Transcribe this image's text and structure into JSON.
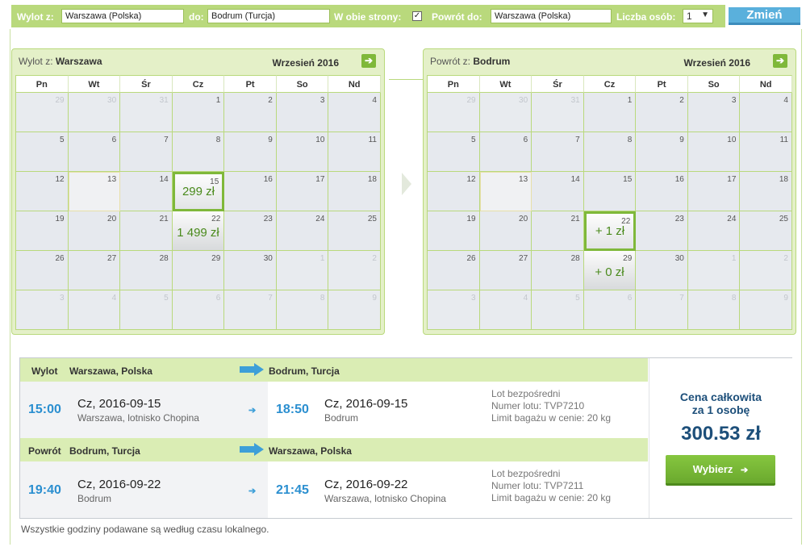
{
  "search": {
    "from_label": "Wylot z:",
    "from_value": "Warszawa (Polska)",
    "to_label": "do:",
    "to_value": "Bodrum (Turcja)",
    "roundtrip_label": "W obie strony:",
    "roundtrip_checked": "✓",
    "return_label": "Powrót do:",
    "return_value": "Warszawa (Polska)",
    "persons_label": "Liczba osób:",
    "persons_value": "1",
    "persons_arrow": "▼",
    "submit_label": "Zmień"
  },
  "weekdays": [
    "Pn",
    "Wt",
    "Śr",
    "Cz",
    "Pt",
    "So",
    "Nd"
  ],
  "outbound_calendar": {
    "title_prefix": "Wylot z:",
    "title_city": "Warszawa",
    "month": "Wrzesień 2016",
    "next_icon": "➔",
    "days": [
      {
        "d": "29",
        "o": true
      },
      {
        "d": "30",
        "o": true
      },
      {
        "d": "31",
        "o": true
      },
      {
        "d": "1"
      },
      {
        "d": "2"
      },
      {
        "d": "3"
      },
      {
        "d": "4"
      },
      {
        "d": "5"
      },
      {
        "d": "6"
      },
      {
        "d": "7"
      },
      {
        "d": "8"
      },
      {
        "d": "9"
      },
      {
        "d": "10"
      },
      {
        "d": "11"
      },
      {
        "d": "12"
      },
      {
        "d": "13",
        "today": true
      },
      {
        "d": "14"
      },
      {
        "d": "15",
        "price": "299 zł",
        "selected": true
      },
      {
        "d": "16"
      },
      {
        "d": "17"
      },
      {
        "d": "18"
      },
      {
        "d": "19"
      },
      {
        "d": "20"
      },
      {
        "d": "21"
      },
      {
        "d": "22",
        "price": "1 499 zł"
      },
      {
        "d": "23"
      },
      {
        "d": "24"
      },
      {
        "d": "25"
      },
      {
        "d": "26"
      },
      {
        "d": "27"
      },
      {
        "d": "28"
      },
      {
        "d": "29"
      },
      {
        "d": "30"
      },
      {
        "d": "1",
        "o": true
      },
      {
        "d": "2",
        "o": true
      },
      {
        "d": "3",
        "o": true
      },
      {
        "d": "4",
        "o": true
      },
      {
        "d": "5",
        "o": true
      },
      {
        "d": "6",
        "o": true
      },
      {
        "d": "7",
        "o": true
      },
      {
        "d": "8",
        "o": true
      },
      {
        "d": "9",
        "o": true
      }
    ]
  },
  "return_calendar": {
    "title_prefix": "Powrót z:",
    "title_city": "Bodrum",
    "month": "Wrzesień 2016",
    "next_icon": "➔",
    "days": [
      {
        "d": "29",
        "o": true
      },
      {
        "d": "30",
        "o": true
      },
      {
        "d": "31",
        "o": true
      },
      {
        "d": "1"
      },
      {
        "d": "2"
      },
      {
        "d": "3"
      },
      {
        "d": "4"
      },
      {
        "d": "5"
      },
      {
        "d": "6"
      },
      {
        "d": "7"
      },
      {
        "d": "8"
      },
      {
        "d": "9"
      },
      {
        "d": "10"
      },
      {
        "d": "11"
      },
      {
        "d": "12"
      },
      {
        "d": "13",
        "today": true
      },
      {
        "d": "14"
      },
      {
        "d": "15"
      },
      {
        "d": "16"
      },
      {
        "d": "17"
      },
      {
        "d": "18"
      },
      {
        "d": "19"
      },
      {
        "d": "20"
      },
      {
        "d": "21"
      },
      {
        "d": "22",
        "price": "+ 1 zł",
        "selected": true
      },
      {
        "d": "23"
      },
      {
        "d": "24"
      },
      {
        "d": "25"
      },
      {
        "d": "26"
      },
      {
        "d": "27"
      },
      {
        "d": "28"
      },
      {
        "d": "29",
        "price": "+ 0 zł"
      },
      {
        "d": "30"
      },
      {
        "d": "1",
        "o": true
      },
      {
        "d": "2",
        "o": true
      },
      {
        "d": "3",
        "o": true
      },
      {
        "d": "4",
        "o": true
      },
      {
        "d": "5",
        "o": true
      },
      {
        "d": "6",
        "o": true
      },
      {
        "d": "7",
        "o": true
      },
      {
        "d": "8",
        "o": true
      },
      {
        "d": "9",
        "o": true
      }
    ]
  },
  "summary": {
    "outbound": {
      "label": "Wylot",
      "from": "Warszawa, Polska",
      "to": "Bodrum, Turcja",
      "dep_time": "15:00",
      "dep_date": "Cz, 2016-09-15",
      "dep_place": "Warszawa, lotnisko Chopina",
      "arr_time": "18:50",
      "arr_date": "Cz, 2016-09-15",
      "arr_place": "Bodrum",
      "info_direct": "Lot bezpośredni",
      "info_flight": "Numer lotu: TVP7210",
      "info_baggage": "Limit bagażu w cenie: 20 kg"
    },
    "return": {
      "label": "Powrót",
      "from": "Bodrum, Turcja",
      "to": "Warszawa, Polska",
      "dep_time": "19:40",
      "dep_date": "Cz, 2016-09-22",
      "dep_place": "Bodrum",
      "arr_time": "21:45",
      "arr_date": "Cz, 2016-09-22",
      "arr_place": "Warszawa, lotnisko Chopina",
      "info_direct": "Lot bezpośredni",
      "info_flight": "Numer lotu: TVP7211",
      "info_baggage": "Limit bagażu w cenie: 20 kg"
    },
    "small_arrow": "➔",
    "total_label_1": "Cena całkowita",
    "total_label_2": "za 1 osobę",
    "total_price": "300.53 zł",
    "select_label": "Wybierz",
    "select_icon": "➔"
  },
  "footer_note": "Wszystkie godziny podawane są według czasu lokalnego.",
  "colors": {
    "accent_green": "#b9d97c",
    "button_blue": "#5ab0dc",
    "price_green": "#4a8a1c",
    "time_blue": "#2b8fd0",
    "total_navy": "#1d4f7a"
  }
}
